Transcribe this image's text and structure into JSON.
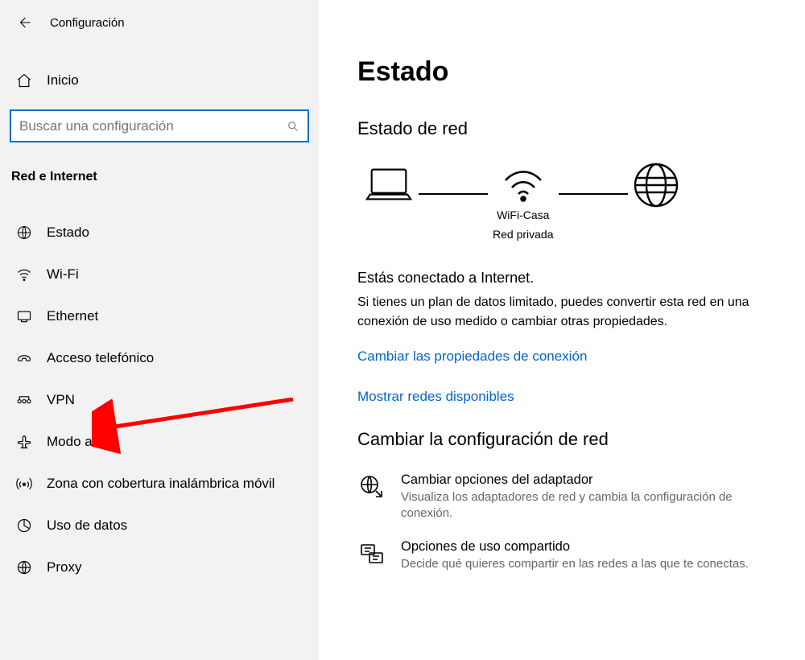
{
  "header": {
    "title": "Configuración"
  },
  "home_label": "Inicio",
  "search": {
    "placeholder": "Buscar una configuración"
  },
  "section_title": "Red e Internet",
  "nav": [
    {
      "label": "Estado",
      "icon": "status-icon"
    },
    {
      "label": "Wi-Fi",
      "icon": "wifi-icon"
    },
    {
      "label": "Ethernet",
      "icon": "ethernet-icon"
    },
    {
      "label": "Acceso telefónico",
      "icon": "dialup-icon"
    },
    {
      "label": "VPN",
      "icon": "vpn-icon"
    },
    {
      "label": "Modo avión",
      "icon": "airplane-icon"
    },
    {
      "label": "Zona con cobertura inalámbrica móvil",
      "icon": "hotspot-icon"
    },
    {
      "label": "Uso de datos",
      "icon": "data-usage-icon"
    },
    {
      "label": "Proxy",
      "icon": "proxy-icon"
    }
  ],
  "main": {
    "heading": "Estado",
    "sub_heading": "Estado de red",
    "network": {
      "name": "WiFi-Casa",
      "type": "Red privada"
    },
    "status_title": "Estás conectado a Internet.",
    "status_desc": "Si tienes un plan de datos limitado, puedes convertir esta red en una conexión de uso medido o cambiar otras propiedades.",
    "link_props": "Cambiar las propiedades de conexión",
    "link_show": "Mostrar redes disponibles",
    "change_heading": "Cambiar la configuración de red",
    "opt1": {
      "title": "Cambiar opciones del adaptador",
      "desc": "Visualiza los adaptadores de red y cambia la configuración de conexión."
    },
    "opt2": {
      "title": "Opciones de uso compartido",
      "desc": "Decide qué quieres compartir en las redes a las que te conectas."
    }
  }
}
